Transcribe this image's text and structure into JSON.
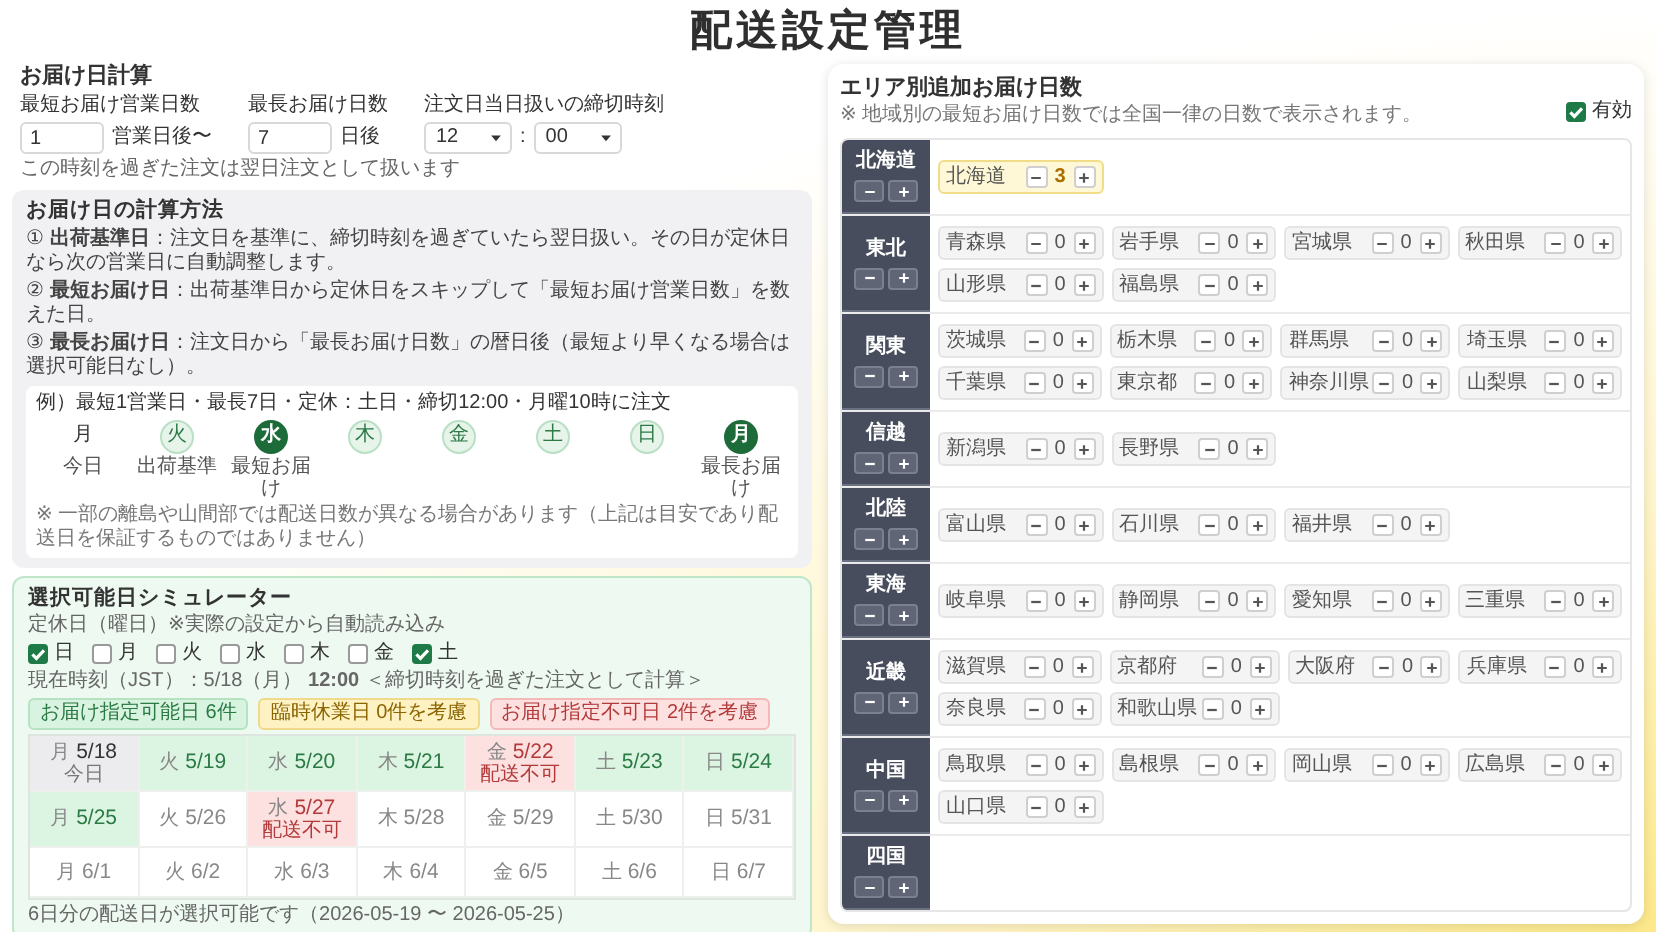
{
  "title": "配送設定管理",
  "delivery_calc": {
    "heading": "お届け日計算",
    "min_days": {
      "label": "最短お届け営業日数",
      "value": "1",
      "suffix": "営業日後〜"
    },
    "max_days": {
      "label": "最長お届け日数",
      "value": "7",
      "suffix": "日後"
    },
    "cutoff": {
      "label": "注文日当日扱いの締切時刻",
      "hint": "この時刻を過ぎた注文は翌日注文として扱います",
      "hour": "12",
      "separator": ":",
      "minute": "00"
    }
  },
  "method": {
    "heading": "お届け日の計算方法",
    "steps": [
      "① **出荷基準日**：注文日を基準に、締切時刻を過ぎていたら翌日扱い。その日が定休日なら次の営業日に自動調整します。",
      "② **最短お届け日**：出荷基準日から定休日をスキップして「最短お届け営業日数」を数えた日。",
      "③ **最長お届け日**：注文日から「最長お届け日数」の暦日後（最短より早くなる場合は選択可能日なし）。"
    ],
    "example": {
      "heading": "例）最短1営業日・最長7日・定休：土日・締切12:00・月曜10時に注文",
      "days": [
        {
          "weekday": "月",
          "note": "今日",
          "kind": "plain"
        },
        {
          "weekday": "火",
          "note": "出荷基準",
          "kind": "ring"
        },
        {
          "weekday": "水",
          "note": "最短お届け",
          "kind": "filled"
        },
        {
          "weekday": "木",
          "kind": "ring"
        },
        {
          "weekday": "金",
          "kind": "ring"
        },
        {
          "weekday": "土",
          "kind": "ring"
        },
        {
          "weekday": "日",
          "kind": "ring"
        },
        {
          "weekday": "月",
          "note": "最長お届け",
          "kind": "filled"
        }
      ],
      "note": "※ 一部の離島や山間部では配送日数が異なる場合があります（上記は目安であり配送日を保証するものではありません）"
    }
  },
  "simulator": {
    "heading": "選択可能日シミュレーター",
    "holiday_label": "定休日（曜日）※実際の設定から自動読み込み",
    "weekdays": [
      {
        "label": "日",
        "checked": true
      },
      {
        "label": "月",
        "checked": false
      },
      {
        "label": "火",
        "checked": false
      },
      {
        "label": "水",
        "checked": false
      },
      {
        "label": "木",
        "checked": false
      },
      {
        "label": "金",
        "checked": false
      },
      {
        "label": "土",
        "checked": true
      }
    ],
    "current_time": "現在時刻（JST）：5/18（月） **12:00** ＜締切時刻を過ぎた注文として計算＞",
    "legend": [
      {
        "label": "お届け指定可能日 6件",
        "kind": "available"
      },
      {
        "label": "臨時休業日 0件を考慮",
        "kind": "closed"
      },
      {
        "label": "お届け指定不可日 2件を考慮",
        "kind": "unavailable"
      }
    ],
    "calendar": [
      {
        "weekday": "月",
        "date": "5/18",
        "note": "今日",
        "kind": "today"
      },
      {
        "weekday": "火",
        "date": "5/19",
        "kind": "available"
      },
      {
        "weekday": "水",
        "date": "5/20",
        "kind": "available"
      },
      {
        "weekday": "木",
        "date": "5/21",
        "kind": "available"
      },
      {
        "weekday": "金",
        "date": "5/22",
        "note": "配送不可",
        "kind": "unavailable"
      },
      {
        "weekday": "土",
        "date": "5/23",
        "kind": "available"
      },
      {
        "weekday": "日",
        "date": "5/24",
        "kind": "available"
      },
      {
        "weekday": "月",
        "date": "5/25",
        "kind": "available"
      },
      {
        "weekday": "火",
        "date": "5/26",
        "kind": "plain"
      },
      {
        "weekday": "水",
        "date": "5/27",
        "note": "配送不可",
        "kind": "unavailable"
      },
      {
        "weekday": "木",
        "date": "5/28",
        "kind": "plain"
      },
      {
        "weekday": "金",
        "date": "5/29",
        "kind": "plain"
      },
      {
        "weekday": "土",
        "date": "5/30",
        "kind": "plain"
      },
      {
        "weekday": "日",
        "date": "5/31",
        "kind": "plain"
      },
      {
        "weekday": "月",
        "date": "6/1",
        "kind": "plain"
      },
      {
        "weekday": "火",
        "date": "6/2",
        "kind": "plain"
      },
      {
        "weekday": "水",
        "date": "6/3",
        "kind": "plain"
      },
      {
        "weekday": "木",
        "date": "6/4",
        "kind": "plain"
      },
      {
        "weekday": "金",
        "date": "6/5",
        "kind": "plain"
      },
      {
        "weekday": "土",
        "date": "6/6",
        "kind": "plain"
      },
      {
        "weekday": "日",
        "date": "6/7",
        "kind": "plain"
      }
    ],
    "footer": "6日分の配送日が選択可能です（2026-05-19 〜 2026-05-25）"
  },
  "area": {
    "heading": "エリア別追加お届け日数",
    "note": "※ 地域別の最短お届け日数では全国一律の日数で表示されます。",
    "enabled": {
      "label": "有効",
      "checked": true
    },
    "regions": [
      {
        "name": "北海道",
        "prefectures": [
          {
            "name": "北海道",
            "value": "3",
            "adjusted": true
          }
        ]
      },
      {
        "name": "東北",
        "prefectures": [
          {
            "name": "青森県",
            "value": "0",
            "adjusted": false
          },
          {
            "name": "岩手県",
            "value": "0",
            "adjusted": false
          },
          {
            "name": "宮城県",
            "value": "0",
            "adjusted": false
          },
          {
            "name": "秋田県",
            "value": "0",
            "adjusted": false
          },
          {
            "name": "山形県",
            "value": "0",
            "adjusted": false
          },
          {
            "name": "福島県",
            "value": "0",
            "adjusted": false
          }
        ]
      },
      {
        "name": "関東",
        "prefectures": [
          {
            "name": "茨城県",
            "value": "0",
            "adjusted": false
          },
          {
            "name": "栃木県",
            "value": "0",
            "adjusted": false
          },
          {
            "name": "群馬県",
            "value": "0",
            "adjusted": false
          },
          {
            "name": "埼玉県",
            "value": "0",
            "adjusted": false
          },
          {
            "name": "千葉県",
            "value": "0",
            "adjusted": false
          },
          {
            "name": "東京都",
            "value": "0",
            "adjusted": false
          },
          {
            "name": "神奈川県",
            "value": "0",
            "adjusted": false
          },
          {
            "name": "山梨県",
            "value": "0",
            "adjusted": false
          }
        ]
      },
      {
        "name": "信越",
        "prefectures": [
          {
            "name": "新潟県",
            "value": "0",
            "adjusted": false
          },
          {
            "name": "長野県",
            "value": "0",
            "adjusted": false
          }
        ]
      },
      {
        "name": "北陸",
        "prefectures": [
          {
            "name": "富山県",
            "value": "0",
            "adjusted": false
          },
          {
            "name": "石川県",
            "value": "0",
            "adjusted": false
          },
          {
            "name": "福井県",
            "value": "0",
            "adjusted": false
          }
        ]
      },
      {
        "name": "東海",
        "prefectures": [
          {
            "name": "岐阜県",
            "value": "0",
            "adjusted": false
          },
          {
            "name": "静岡県",
            "value": "0",
            "adjusted": false
          },
          {
            "name": "愛知県",
            "value": "0",
            "adjusted": false
          },
          {
            "name": "三重県",
            "value": "0",
            "adjusted": false
          }
        ]
      },
      {
        "name": "近畿",
        "prefectures": [
          {
            "name": "滋賀県",
            "value": "0",
            "adjusted": false
          },
          {
            "name": "京都府",
            "value": "0",
            "adjusted": false
          },
          {
            "name": "大阪府",
            "value": "0",
            "adjusted": false
          },
          {
            "name": "兵庫県",
            "value": "0",
            "adjusted": false
          },
          {
            "name": "奈良県",
            "value": "0",
            "adjusted": false
          },
          {
            "name": "和歌山県",
            "value": "0",
            "adjusted": false
          }
        ]
      },
      {
        "name": "中国",
        "prefectures": [
          {
            "name": "鳥取県",
            "value": "0",
            "adjusted": false
          },
          {
            "name": "島根県",
            "value": "0",
            "adjusted": false
          },
          {
            "name": "岡山県",
            "value": "0",
            "adjusted": false
          },
          {
            "name": "広島県",
            "value": "0",
            "adjusted": false
          },
          {
            "name": "山口県",
            "value": "0",
            "adjusted": false
          }
        ]
      },
      {
        "name": "四国"
      }
    ]
  }
}
